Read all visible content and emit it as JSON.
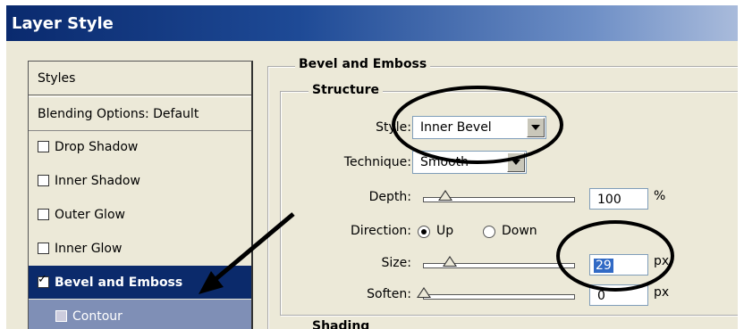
{
  "window": {
    "title": "Layer Style"
  },
  "styles_panel": {
    "items": [
      {
        "label": "Styles",
        "kind": "header"
      },
      {
        "label": "Blending Options: Default",
        "kind": "header"
      },
      {
        "label": "Drop Shadow",
        "checked": false
      },
      {
        "label": "Inner Shadow",
        "checked": false
      },
      {
        "label": "Outer Glow",
        "checked": false
      },
      {
        "label": "Inner Glow",
        "checked": false
      },
      {
        "label": "Bevel and Emboss",
        "checked": true,
        "selected": true
      },
      {
        "label": "Contour",
        "checked": false,
        "sub": true
      }
    ]
  },
  "bevel": {
    "section_title": "Bevel and Emboss",
    "structure_title": "Structure",
    "style_label": "Style:",
    "style_value": "Inner Bevel",
    "technique_label": "Technique:",
    "technique_value": "Smooth",
    "depth_label": "Depth:",
    "depth_value": "100",
    "depth_unit": "%",
    "direction_label": "Direction:",
    "direction_up": "Up",
    "direction_down": "Down",
    "direction_selected": "Up",
    "size_label": "Size:",
    "size_value": "29",
    "size_unit": "px",
    "soften_label": "Soften:",
    "soften_value": "0",
    "soften_unit": "px",
    "shading_title": "Shading"
  },
  "colors": {
    "selected_bg": "#0b2a6b",
    "annotation": "#000000"
  }
}
